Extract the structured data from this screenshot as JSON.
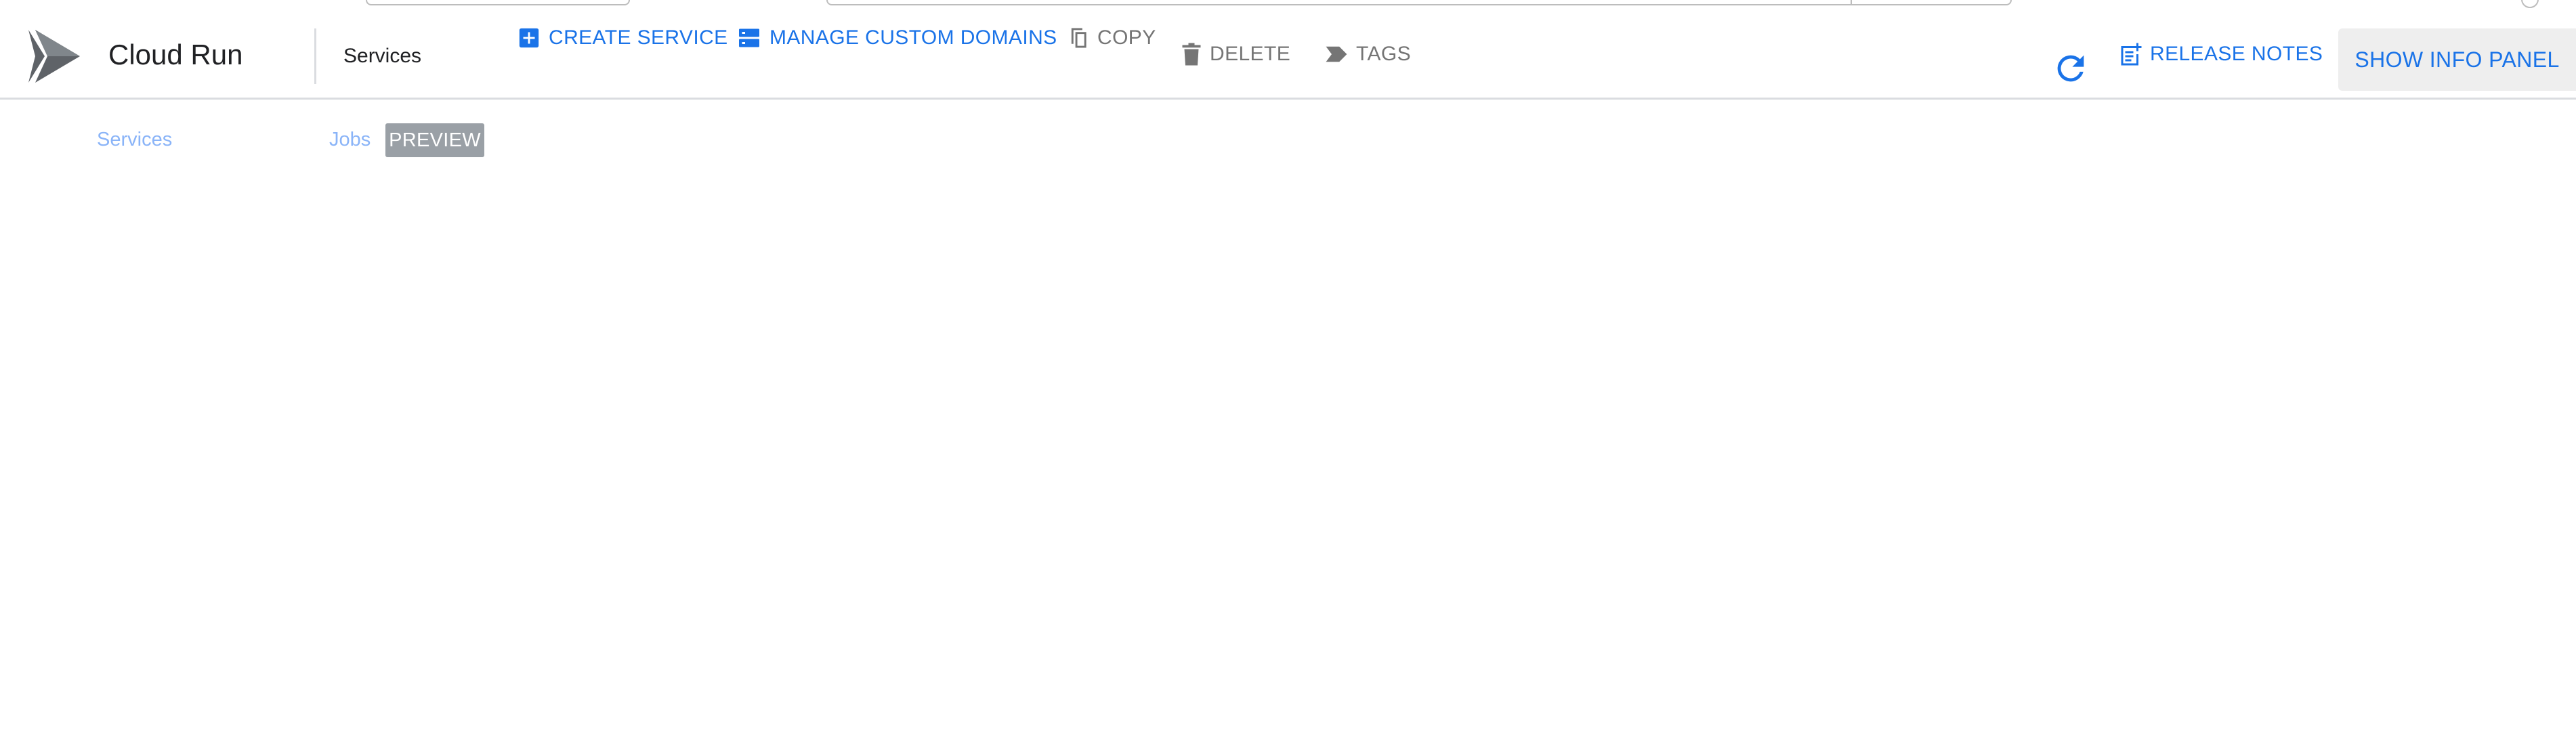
{
  "app": {
    "product_name": "Cloud Run",
    "page_title": "Services",
    "logo_icon": "cloud-run-logo"
  },
  "toolbar": {
    "create_service": "CREATE SERVICE",
    "manage_domains": "MANAGE CUSTOM DOMAINS",
    "copy": "COPY",
    "delete": "DELETE",
    "tags": "TAGS",
    "release_notes": "RELEASE NOTES",
    "show_info_panel": "SHOW INFO PANEL",
    "icons": {
      "create": "add-box-icon",
      "domains": "domains-list-icon",
      "copy": "copy-icon",
      "delete": "trash-icon",
      "tags": "tag-icon",
      "refresh": "refresh-icon",
      "release_notes": "release-notes-icon"
    }
  },
  "tabs": [
    {
      "label": "Services"
    },
    {
      "label": "Jobs",
      "badge": "PREVIEW"
    }
  ],
  "colors": {
    "accent": "#1a73e8",
    "disabled": "#757575",
    "tab_text": "#8ab4f8",
    "badge_bg": "#9aa0a6",
    "info_panel_bg": "#eeeeee"
  }
}
